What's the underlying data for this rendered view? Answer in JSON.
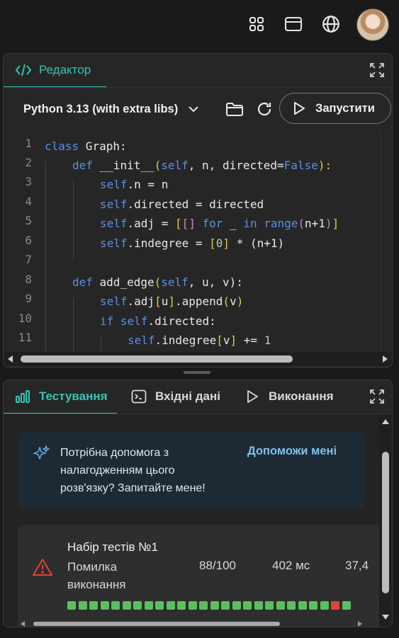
{
  "topbar": {
    "icons": [
      "grid-icon",
      "window-icon",
      "globe-icon"
    ],
    "avatar": "avatar"
  },
  "editor": {
    "tab_label": "Редактор",
    "language": "Python 3.13 (with extra libs)",
    "run_label": "Запустити",
    "code_lines": [
      {
        "n": "1"
      },
      {
        "n": "2"
      },
      {
        "n": "3"
      },
      {
        "n": "4"
      },
      {
        "n": "5"
      },
      {
        "n": "6"
      },
      {
        "n": "7"
      },
      {
        "n": "8"
      },
      {
        "n": "9"
      },
      {
        "n": "10"
      },
      {
        "n": "11"
      }
    ],
    "code": {
      "l1a": "class",
      "l1b": " Graph:",
      "l2a": "def",
      "l2b": " __init__",
      "l2c": "(",
      "l2d": "self",
      "l2e": ", n, directed=",
      "l2f": "False",
      "l2g": "):",
      "l3a": "self",
      "l3b": ".n = n",
      "l4a": "self",
      "l4b": ".directed = directed",
      "l5a": "self",
      "l5b": ".adj = ",
      "l5c": "[",
      "l5d": "[]",
      "l5e": " for",
      "l5f": " _ ",
      "l5g": "in",
      "l5h": " range",
      "l5i": "(",
      "l5j": "n+1",
      "l5k": ")",
      "l5l": "]",
      "l6a": "self",
      "l6b": ".indegree = ",
      "l6c": "[",
      "l6d": "0",
      "l6e": "]",
      "l6f": " * (n+1)",
      "l8a": "def",
      "l8b": " add_edge",
      "l8c": "(",
      "l8d": "self",
      "l8e": ", u, v):",
      "l9a": "self",
      "l9b": ".adj",
      "l9c": "[",
      "l9d": "u",
      "l9e": "]",
      "l9f": ".append",
      "l9g": "(",
      "l9h": "v",
      "l9i": ")",
      "l10a": "if",
      "l10b": " self",
      "l10c": ".directed:",
      "l11a": "self",
      "l11b": ".indegree",
      "l11c": "[",
      "l11d": "v",
      "l11e": "]",
      "l11f": " += ",
      "l11g": "1"
    }
  },
  "bottom": {
    "tabs": [
      "Тестування",
      "Вхідні дані",
      "Виконання"
    ],
    "help_text": "Потрібна допомога з налагодженням цього розв'язку? Запитайте мене!",
    "help_button": "Допоможи мені",
    "test_set": {
      "title": "Набір тестів №1",
      "status_line1": "Помилка",
      "status_line2": "виконання",
      "score": "88/100",
      "time": "402 мс",
      "memory": "37,4"
    },
    "test_results": [
      "ok",
      "ok",
      "ok",
      "ok",
      "ok",
      "ok",
      "ok",
      "ok",
      "ok",
      "ok",
      "ok",
      "ok",
      "ok",
      "ok",
      "ok",
      "ok",
      "ok",
      "ok",
      "ok",
      "ok",
      "ok",
      "ok",
      "ok",
      "ok",
      "fail",
      "ok"
    ]
  },
  "colors": {
    "accent": "#36c5b8",
    "pass": "#5cbf5f",
    "fail": "#e0433a"
  }
}
